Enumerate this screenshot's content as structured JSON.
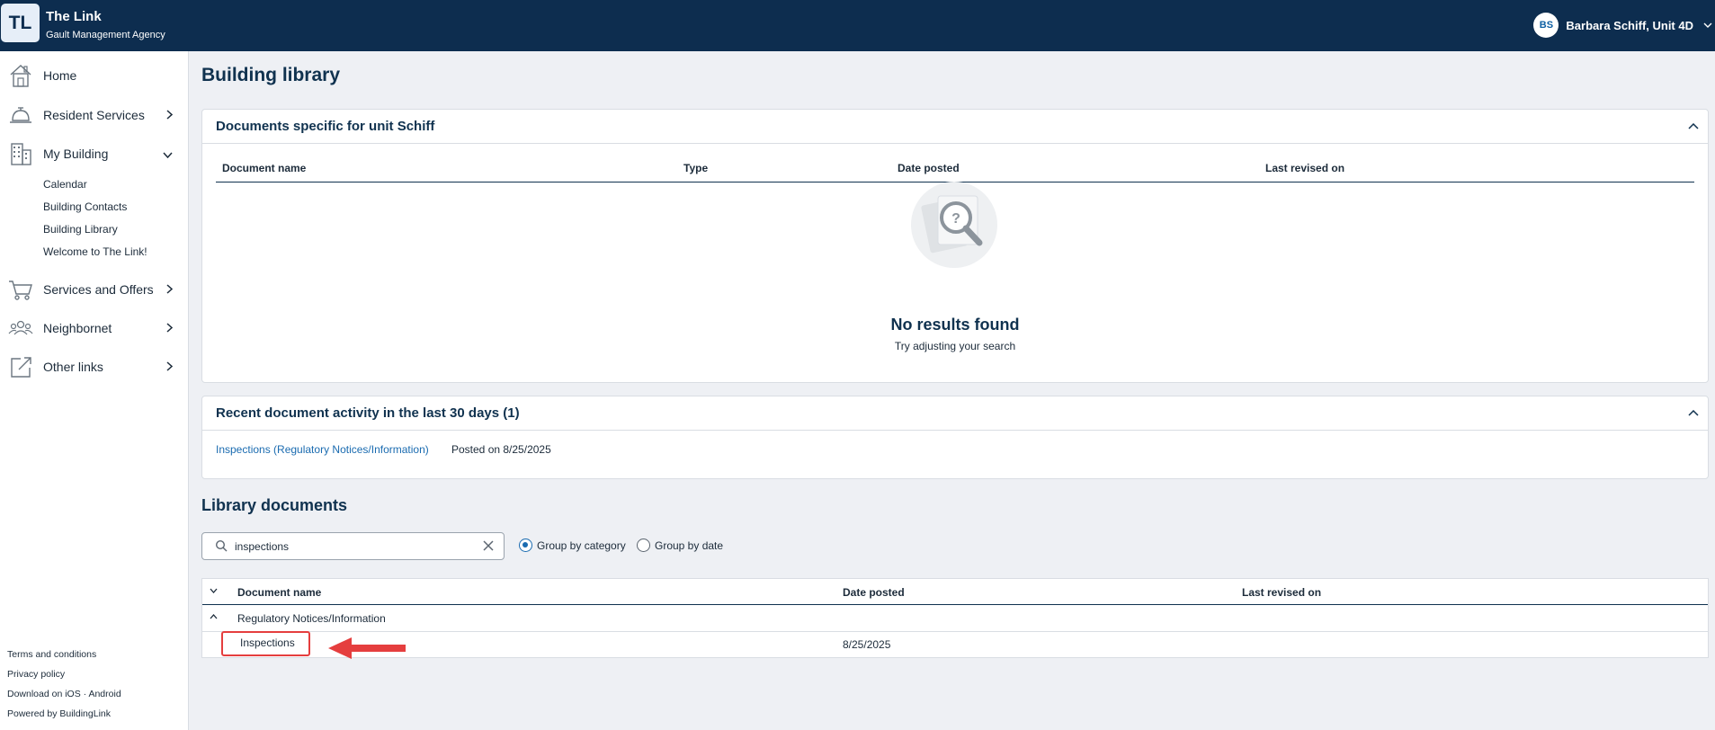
{
  "app": {
    "logo": "TL",
    "title": "The Link",
    "subtitle": "Gault Management Agency"
  },
  "user": {
    "initials": "BS",
    "name": "Barbara Schiff, Unit 4D"
  },
  "sidebar": {
    "items": [
      {
        "label": "Home",
        "icon": "home-icon"
      },
      {
        "label": "Resident Services",
        "icon": "bell-icon"
      },
      {
        "label": "My Building",
        "icon": "building-icon"
      },
      {
        "label": "Services and Offers",
        "icon": "cart-icon"
      },
      {
        "label": "Neighbornet",
        "icon": "people-icon"
      },
      {
        "label": "Other links",
        "icon": "external-link-icon"
      }
    ],
    "my_building_sub": [
      "Calendar",
      "Building Contacts",
      "Building Library",
      "Welcome to The Link!"
    ],
    "footer": [
      "Terms and conditions",
      "Privacy policy",
      "Download on iOS · Android",
      "Powered by BuildingLink"
    ]
  },
  "page": {
    "title": "Building library"
  },
  "unit_docs": {
    "title": "Documents specific for unit Schiff",
    "columns": [
      "Document name",
      "Type",
      "Date posted",
      "Last revised on"
    ],
    "empty_title": "No results found",
    "empty_sub": "Try adjusting your search"
  },
  "recent": {
    "title": "Recent document activity in the last 30 days (1)",
    "items": [
      {
        "link": "Inspections (Regulatory Notices/Information)",
        "posted": "Posted on 8/25/2025"
      }
    ]
  },
  "library": {
    "title": "Library documents",
    "search_value": "inspections",
    "group_options": [
      "Group by category",
      "Group by date"
    ],
    "selected_group": "Group by category",
    "columns": [
      "Document name",
      "Date posted",
      "Last revised on"
    ],
    "category": "Regulatory Notices/Information",
    "rows": [
      {
        "name": "Inspections",
        "date_posted": "8/25/2025",
        "last_revised": ""
      }
    ]
  },
  "colors": {
    "header_bg": "#0d2d4f",
    "link": "#1a6bb0",
    "highlight": "#e53e3e"
  }
}
